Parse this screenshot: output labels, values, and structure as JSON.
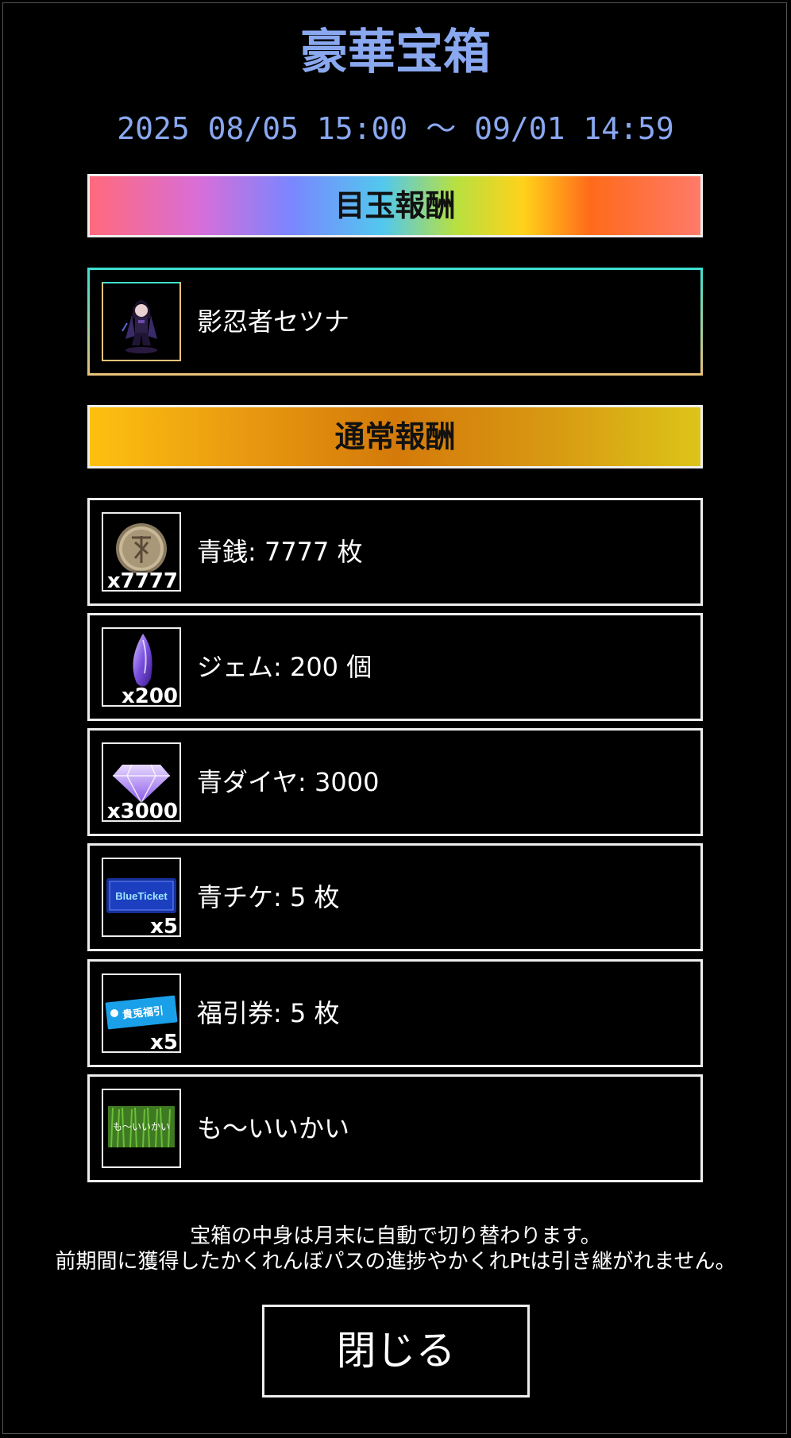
{
  "title": "豪華宝箱",
  "period": "2025 08/05 15:00 〜 09/01 14:59",
  "featured_section": {
    "header": "目玉報酬",
    "items": [
      {
        "name": "影忍者セツナ",
        "icon": "ninja-character-icon"
      }
    ]
  },
  "normal_section": {
    "header": "通常報酬",
    "items": [
      {
        "label": "青銭: 7777 枚",
        "qty": "x7777",
        "icon": "coin-icon"
      },
      {
        "label": "ジェム: 200 個",
        "qty": "x200",
        "icon": "gem-icon"
      },
      {
        "label": "青ダイヤ: 3000",
        "qty": "x3000",
        "icon": "diamond-icon"
      },
      {
        "label": "青チケ: 5 枚",
        "qty": "x5",
        "icon": "blue-ticket-icon",
        "icon_text": "BlueTicket"
      },
      {
        "label": "福引券: 5 枚",
        "qty": "x5",
        "icon": "lottery-ticket-icon",
        "icon_text": "貴兎福引"
      },
      {
        "label": "も〜いいかい",
        "qty": "",
        "icon": "grass-title-icon",
        "icon_text": "も〜いいかい"
      }
    ]
  },
  "notes": [
    "宝箱の中身は月末に自動で切り替わります。",
    "前期間に獲得したかくれんぼパスの進捗やかくれPtは引き継がれません。"
  ],
  "close_label": "閉じる",
  "colors": {
    "title": "#8aa8f0",
    "background": "#000000",
    "border": "#eeeeee"
  }
}
